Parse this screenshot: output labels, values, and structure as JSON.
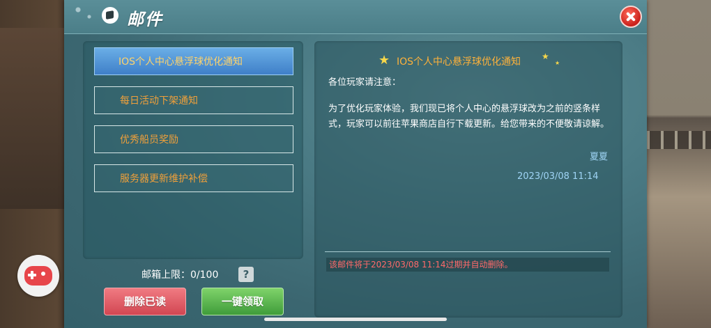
{
  "window": {
    "title": "邮件"
  },
  "mail_list": [
    {
      "label": "IOS个人中心悬浮球优化通知",
      "selected": true
    },
    {
      "label": "每日活动下架通知",
      "selected": false
    },
    {
      "label": "优秀船员奖励",
      "selected": false
    },
    {
      "label": "服务器更新维护补偿",
      "selected": false
    }
  ],
  "mailbox": {
    "cap_label": "邮箱上限：0/100",
    "help_label": "?"
  },
  "buttons": {
    "delete_read": "删除已读",
    "claim_all": "一键领取"
  },
  "detail": {
    "title": "IOS个人中心悬浮球优化通知",
    "greeting": "各位玩家请注意：",
    "body": "为了优化玩家体验，我们现已将个人中心的悬浮球改为之前的竖条样式，玩家可以前往苹果商店自行下载更新。给您带来的不便敬请谅解。",
    "signature": "夏夏",
    "date": "2023/03/08 11:14",
    "expire_notice": "该邮件将于2023/03/08 11:14过期并自动删除。"
  },
  "colors": {
    "accent_orange": "#f0a03a",
    "delete_red": "#d24652",
    "claim_green": "#3f9c3a",
    "selected_blue": "#3f7fc8"
  }
}
